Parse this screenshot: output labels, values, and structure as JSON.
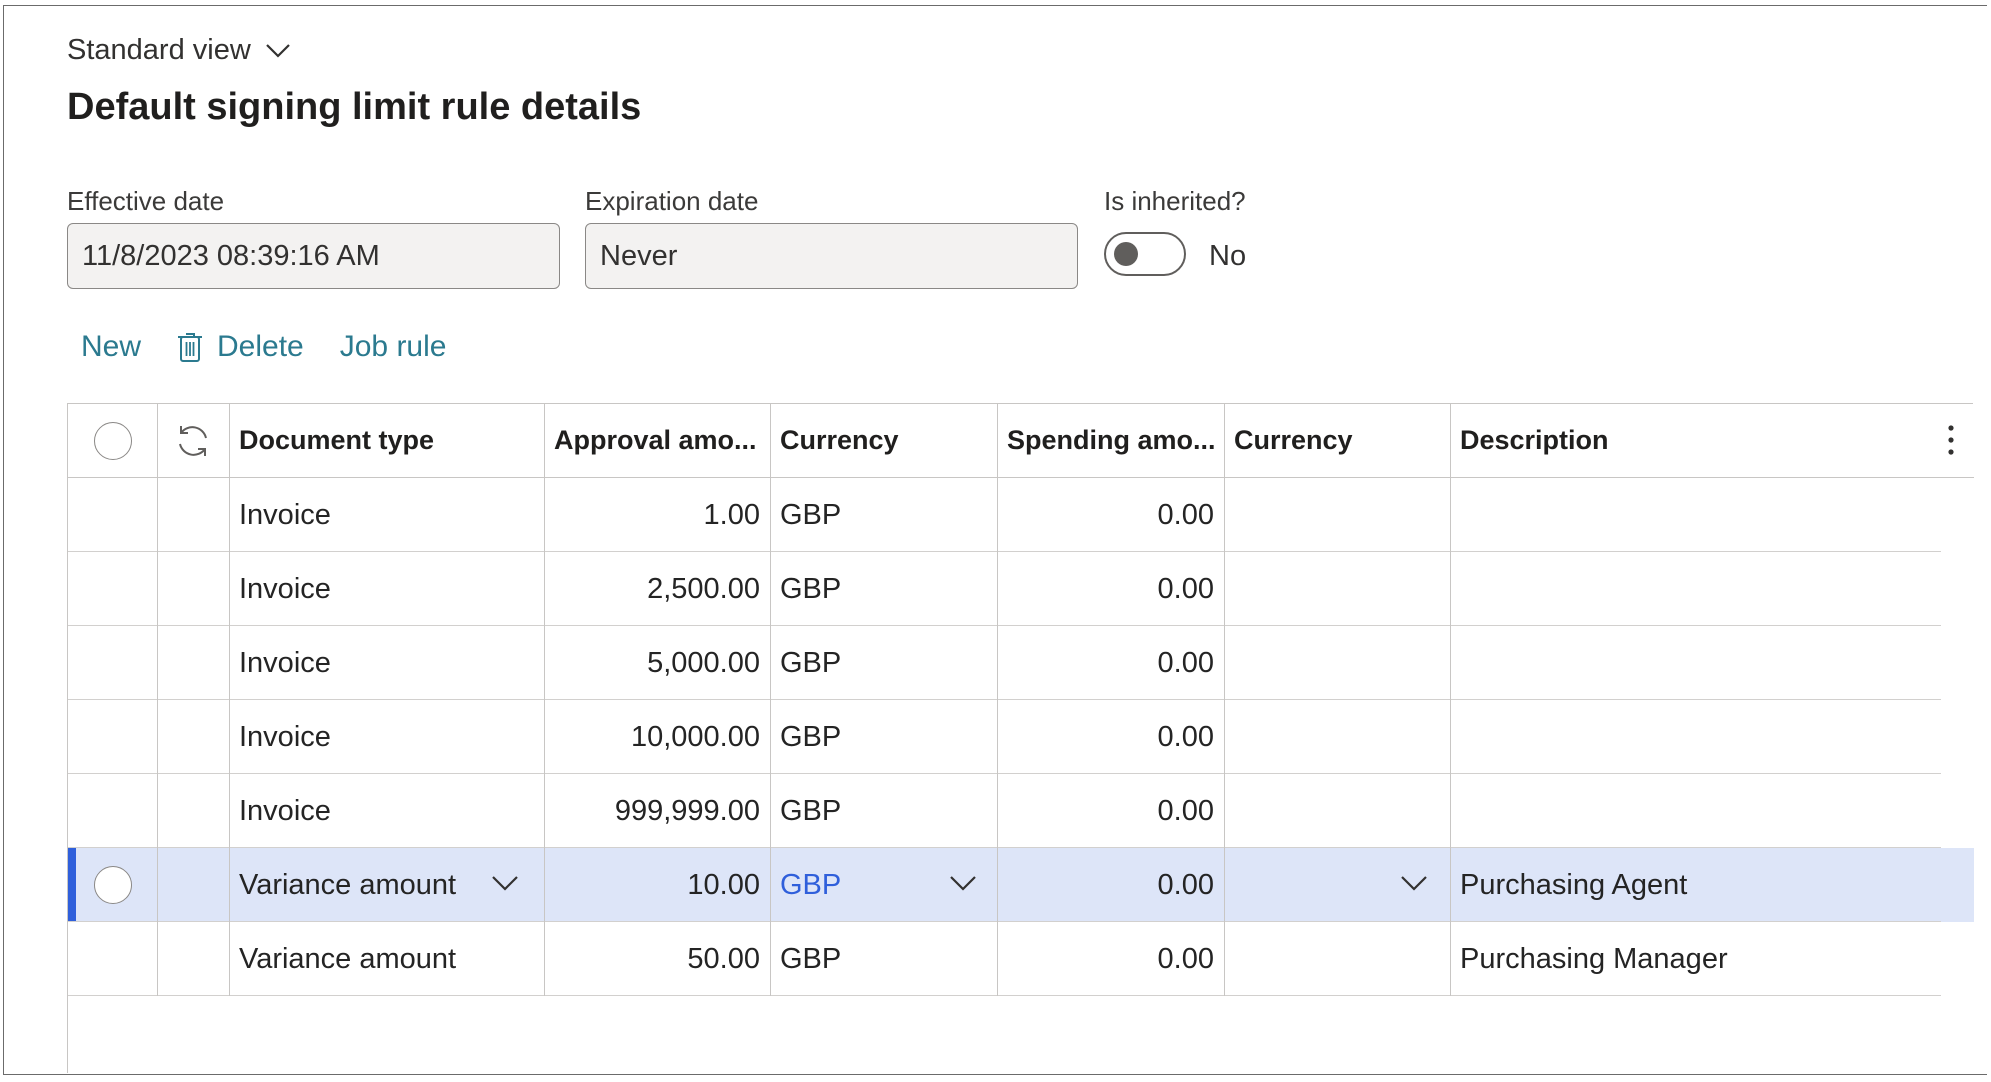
{
  "view": {
    "label": "Standard view"
  },
  "page": {
    "title": "Default signing limit rule details"
  },
  "fields": {
    "effective": {
      "label": "Effective date",
      "value": "11/8/2023 08:39:16 AM"
    },
    "expiration": {
      "label": "Expiration date",
      "value": "Never"
    },
    "inherited": {
      "label": "Is inherited?",
      "value": "No"
    }
  },
  "actions": {
    "new": "New",
    "delete": "Delete",
    "job_rule": "Job rule"
  },
  "grid": {
    "headers": {
      "document_type": "Document type",
      "approval_amount": "Approval amo...",
      "currency1": "Currency",
      "spending_amount": "Spending amo...",
      "currency2": "Currency",
      "description": "Description"
    },
    "rows": [
      {
        "document_type": "Invoice",
        "approval_amount": "1.00",
        "currency1": "GBP",
        "spending_amount": "0.00",
        "currency2": "",
        "description": ""
      },
      {
        "document_type": "Invoice",
        "approval_amount": "2,500.00",
        "currency1": "GBP",
        "spending_amount": "0.00",
        "currency2": "",
        "description": ""
      },
      {
        "document_type": "Invoice",
        "approval_amount": "5,000.00",
        "currency1": "GBP",
        "spending_amount": "0.00",
        "currency2": "",
        "description": ""
      },
      {
        "document_type": "Invoice",
        "approval_amount": "10,000.00",
        "currency1": "GBP",
        "spending_amount": "0.00",
        "currency2": "",
        "description": ""
      },
      {
        "document_type": "Invoice",
        "approval_amount": "999,999.00",
        "currency1": "GBP",
        "spending_amount": "0.00",
        "currency2": "",
        "description": ""
      },
      {
        "document_type": "Variance amount",
        "approval_amount": "10.00",
        "currency1": "GBP",
        "spending_amount": "0.00",
        "currency2": "",
        "description": "Purchasing Agent",
        "selected": true
      },
      {
        "document_type": "Variance amount",
        "approval_amount": "50.00",
        "currency1": "GBP",
        "spending_amount": "0.00",
        "currency2": "",
        "description": "Purchasing Manager"
      }
    ]
  },
  "colors": {
    "accent": "#2f5fdb",
    "link": "#2b7a8f",
    "selected_row": "#dde5f8"
  }
}
